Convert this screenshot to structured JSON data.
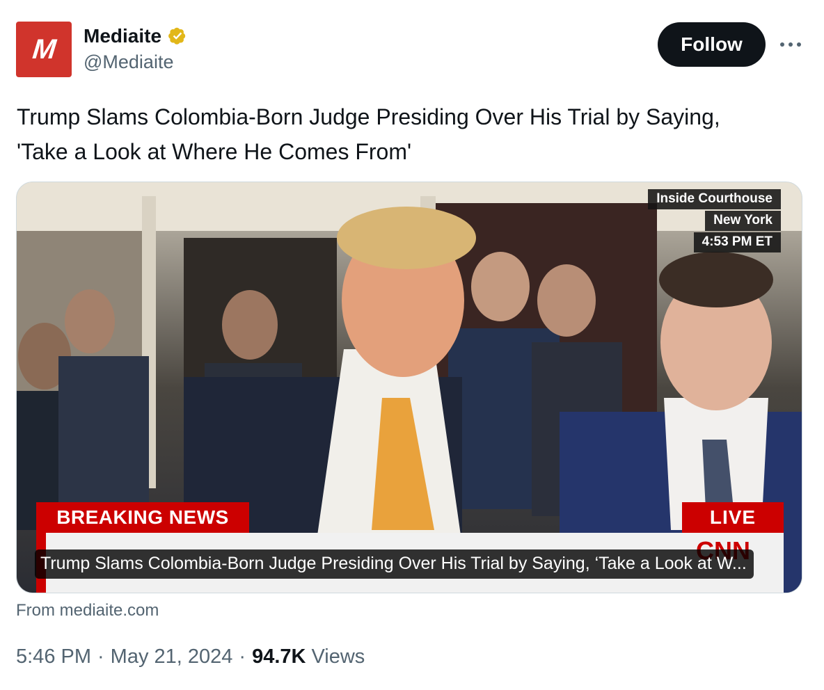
{
  "author": {
    "avatar_letter": "M",
    "display_name": "Mediaite",
    "handle": "@Mediaite",
    "verified_badge": "gold-verified-badge-icon"
  },
  "actions": {
    "follow_label": "Follow",
    "more_icon": "more-horizontal-icon"
  },
  "tweet": {
    "text_line1": "Trump Slams Colombia-Born Judge Presiding Over His Trial by Saying,",
    "text_line2": "'Take a Look at Where He Comes From'"
  },
  "card": {
    "overlay": {
      "location": "Inside Courthouse",
      "city": "New York",
      "time": "4:53 PM ET",
      "breaking": "BREAKING NEWS",
      "live": "LIVE",
      "network_logo": "CNN"
    },
    "caption": "Trump Slams Colombia-Born Judge Presiding Over His Trial by Saying, ‘Take a Look at W...",
    "source": "From mediaite.com"
  },
  "meta": {
    "time": "5:46 PM",
    "separator": "·",
    "date": "May 21, 2024",
    "views_count": "94.7K",
    "views_label": "Views"
  },
  "colors": {
    "brand": "#d0342c",
    "breaking_red": "#cc0000",
    "verified_gold": "#e2b719",
    "text_primary": "#0f1419",
    "text_secondary": "#536471"
  }
}
